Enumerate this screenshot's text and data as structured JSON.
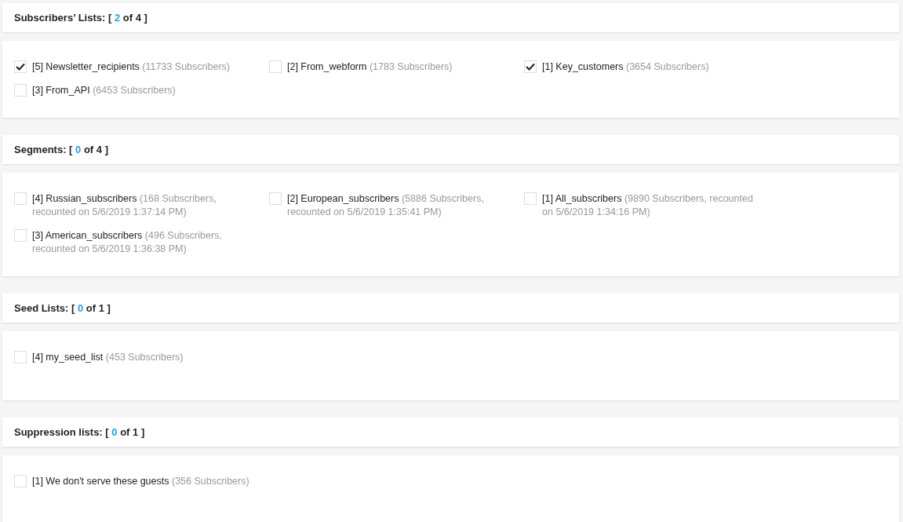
{
  "sections": [
    {
      "title": "Subscribers’ Lists:",
      "count_open": "[",
      "count": "2",
      "count_close": "of 4 ]",
      "items": [
        {
          "label": "[5] Newsletter_recipients",
          "details": "(11733 Subscribers)",
          "checked": true
        },
        {
          "label": "[2] From_webform",
          "details": "(1783 Subscribers)",
          "checked": false
        },
        {
          "label": "[1] Key_customers",
          "details": "(3654 Subscribers)",
          "checked": true
        },
        {
          "label": "[3] From_API",
          "details": "(6453 Subscribers)",
          "checked": false
        }
      ]
    },
    {
      "title": "Segments:",
      "count_open": "[",
      "count": "0",
      "count_close": "of 4 ]",
      "items": [
        {
          "label": "[4] Russian_subscribers",
          "details": "(168 Subscribers, recounted on 5/6/2019 1:37:14 PM)",
          "checked": false
        },
        {
          "label": "[2] European_subscribers",
          "details": "(5886 Subscribers, recounted on 5/6/2019 1:35:41 PM)",
          "checked": false
        },
        {
          "label": "[1] All_subscribers",
          "details": "(9890 Subscribers, recounted on 5/6/2019 1:34:16 PM)",
          "checked": false
        },
        {
          "label": "[3] American_subscribers",
          "details": "(496 Subscribers, recounted on 5/6/2019 1:36:38 PM)",
          "checked": false
        }
      ]
    },
    {
      "title": "Seed Lists:",
      "count_open": "[",
      "count": "0",
      "count_close": "of 1 ]",
      "items": [
        {
          "label": "[4] my_seed_list",
          "details": "(453 Subscribers)",
          "checked": false
        }
      ]
    },
    {
      "title": "Suppression lists:",
      "count_open": "[",
      "count": "0",
      "count_close": "of 1 ]",
      "items": [
        {
          "label": "[1] We don't serve these guests",
          "details": "(356 Subscribers)",
          "checked": false
        }
      ]
    }
  ]
}
